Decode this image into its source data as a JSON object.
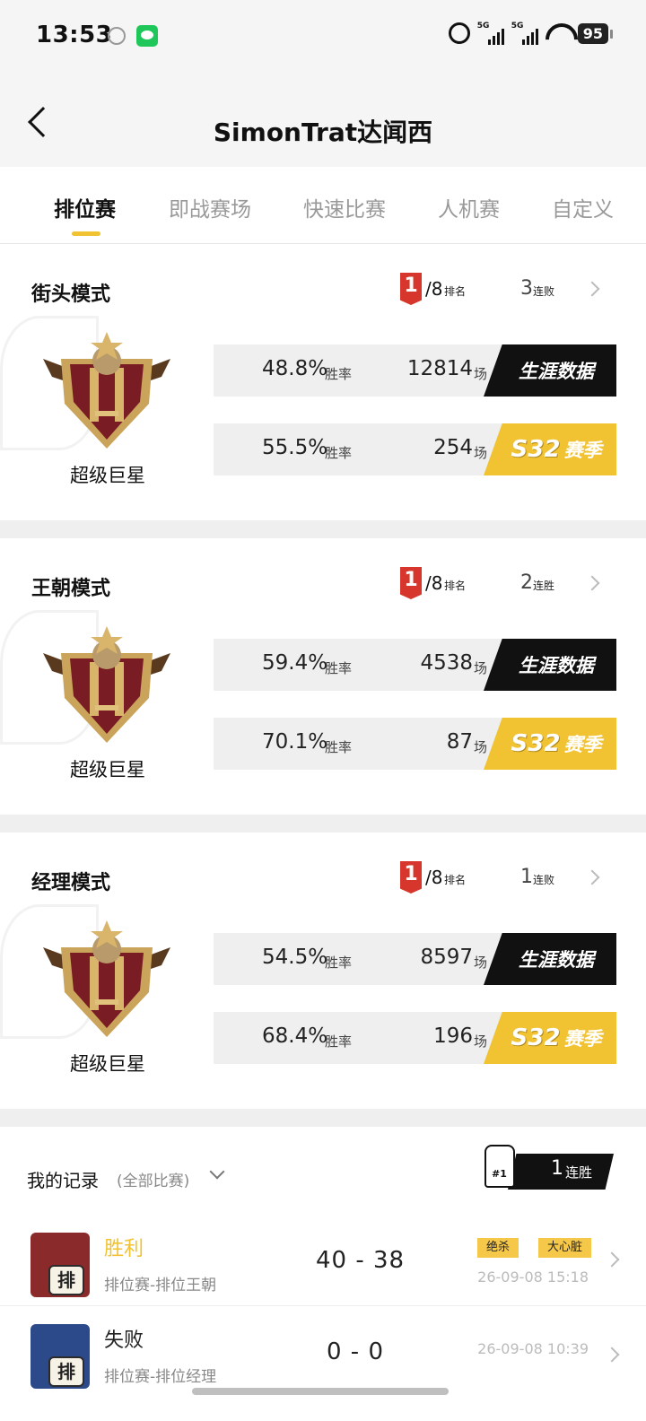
{
  "status_bar": {
    "time": "13:53",
    "network_1": "5G",
    "network_2": "5G",
    "battery": "95"
  },
  "header": {
    "title": "SimonTrat达闻西"
  },
  "tabs": [
    "排位赛",
    "即战赛场",
    "快速比赛",
    "人机赛",
    "自定义"
  ],
  "active_tab": 0,
  "modes": [
    {
      "title": "街头模式",
      "rank": "1",
      "rank_total": "/8",
      "rank_label": "排名",
      "streak_num": "3",
      "streak_label": "连败",
      "badge_label": "超级巨星",
      "career": {
        "rate": "48.8%",
        "rate_label": "胜率",
        "games": "12814",
        "games_label": "场",
        "tag": "生涯数据"
      },
      "season": {
        "rate": "55.5%",
        "rate_label": "胜率",
        "games": "254",
        "games_label": "场",
        "tag_s": "S32",
        "tag": "赛季"
      }
    },
    {
      "title": "王朝模式",
      "rank": "1",
      "rank_total": "/8",
      "rank_label": "排名",
      "streak_num": "2",
      "streak_label": "连胜",
      "badge_label": "超级巨星",
      "career": {
        "rate": "59.4%",
        "rate_label": "胜率",
        "games": "4538",
        "games_label": "场",
        "tag": "生涯数据"
      },
      "season": {
        "rate": "70.1%",
        "rate_label": "胜率",
        "games": "87",
        "games_label": "场",
        "tag_s": "S32",
        "tag": "赛季"
      }
    },
    {
      "title": "经理模式",
      "rank": "1",
      "rank_total": "/8",
      "rank_label": "排名",
      "streak_num": "1",
      "streak_label": "连败",
      "badge_label": "超级巨星",
      "career": {
        "rate": "54.5%",
        "rate_label": "胜率",
        "games": "8597",
        "games_label": "场",
        "tag": "生涯数据"
      },
      "season": {
        "rate": "68.4%",
        "rate_label": "胜率",
        "games": "196",
        "games_label": "场",
        "tag_s": "S32",
        "tag": "赛季"
      }
    }
  ],
  "records": {
    "title": "我的记录",
    "filter": "(全部比赛)",
    "win_streak_num": "1",
    "win_streak_label": "连胜",
    "rows": [
      {
        "result": "胜利",
        "mode": "排位赛-排位王朝",
        "score": "40 - 38",
        "tags": [
          "绝杀",
          "大心脏"
        ],
        "time": "26-09-08 15:18"
      },
      {
        "result": "失败",
        "mode": "排位赛-排位经理",
        "score": "0 - 0",
        "tags": [],
        "time": "26-09-08 10:39"
      }
    ],
    "icon_text": "排"
  },
  "colors": {
    "accent_yellow": "#f1c231",
    "rank_red": "#d6362b",
    "dark": "#111111"
  }
}
